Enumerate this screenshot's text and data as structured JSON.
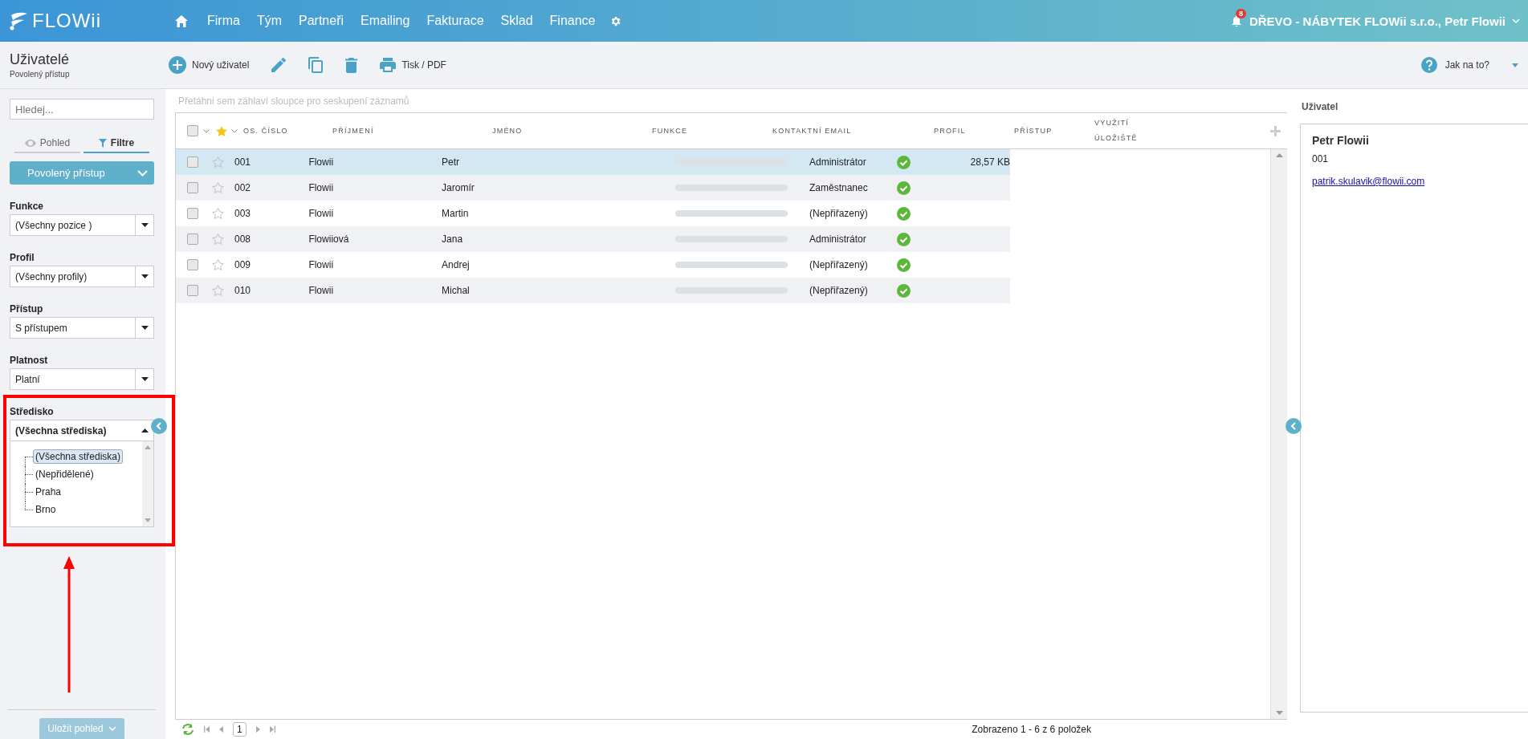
{
  "app": {
    "logo": "FLOWii",
    "nav": [
      "Firma",
      "Tým",
      "Partneři",
      "Emailing",
      "Fakturace",
      "Sklad",
      "Finance"
    ],
    "notifications": "8",
    "account": "DŘEVO - NÁBYTEK FLOWii s.r.o., Petr Flowii"
  },
  "page": {
    "title": "Uživatelé",
    "subtitle": "Povolený přístup"
  },
  "toolbar": {
    "new": "Nový uživatel",
    "print": "Tisk / PDF",
    "help": "Jak na to?"
  },
  "sidebar": {
    "search": {
      "placeholder": "Hledej..."
    },
    "tabs": [
      {
        "label": "Pohled",
        "selected": false
      },
      {
        "label": "Filtre",
        "selected": true
      }
    ],
    "preset": "Povolený přístup",
    "filters": [
      {
        "label": "Funkce",
        "value": "(Všechny pozice )",
        "expanded": false
      },
      {
        "label": "Profil",
        "value": "(Všechny profily)",
        "expanded": false
      },
      {
        "label": "Přístup",
        "value": "S přístupem",
        "expanded": false
      },
      {
        "label": "Platnost",
        "value": "Platní",
        "expanded": false
      },
      {
        "label": "Středisko",
        "value": "(Všechna střediska)",
        "expanded": true,
        "options": [
          {
            "label": "(Všechna střediska)",
            "selected": true
          },
          {
            "label": "(Nepřidělené)",
            "selected": false
          },
          {
            "label": "Praha",
            "selected": false
          },
          {
            "label": "Brno",
            "selected": false
          }
        ]
      }
    ],
    "save": {
      "label": "Uložit pohled",
      "disabled": true
    }
  },
  "grid": {
    "group_hint": "Přetáhni sem záhlaví sloupce pro seskupení záznamů",
    "all_checked": false,
    "columns": [
      "OS. ČÍSLO",
      "PŘÍJMENÍ",
      "JMÉNO",
      "FUNKCE",
      "KONTAKTNÍ EMAIL",
      "PROFIL",
      "PŘÍSTUP",
      "VYUŽITÍ ÚLOŽIŠTĚ"
    ],
    "rows": [
      {
        "selected": true,
        "checked": false,
        "starred": false,
        "number": "001",
        "surname": "Flowii",
        "name": "Petr",
        "profile": "Administrátor",
        "access": true,
        "storage": "28,57 KB"
      },
      {
        "selected": false,
        "checked": false,
        "starred": false,
        "number": "002",
        "surname": "Flowii",
        "name": "Jaromír",
        "profile": "Zaměstnanec",
        "access": true
      },
      {
        "selected": false,
        "checked": false,
        "starred": false,
        "number": "003",
        "surname": "Flowii",
        "name": "Martin",
        "profile": "(Nepřiřazený)",
        "access": true
      },
      {
        "selected": false,
        "checked": false,
        "starred": false,
        "number": "008",
        "surname": "Flowiiová",
        "name": "Jana",
        "profile": "Administrátor",
        "access": true
      },
      {
        "selected": false,
        "checked": false,
        "starred": false,
        "number": "009",
        "surname": "Flowii",
        "name": "Andrej",
        "profile": "(Nepřiřazený)",
        "access": true
      },
      {
        "selected": false,
        "checked": false,
        "starred": false,
        "number": "010",
        "surname": "Flowii",
        "name": "Michal",
        "profile": "(Nepřiřazený)",
        "access": true
      }
    ]
  },
  "pager": {
    "page": "1",
    "summary": "Zobrazeno 1 - 6 z 6 položek"
  },
  "detail": {
    "tab": "Uživatel",
    "name": "Petr Flowii",
    "number": "001",
    "email": "patrik.skulavik@flowii.com"
  }
}
